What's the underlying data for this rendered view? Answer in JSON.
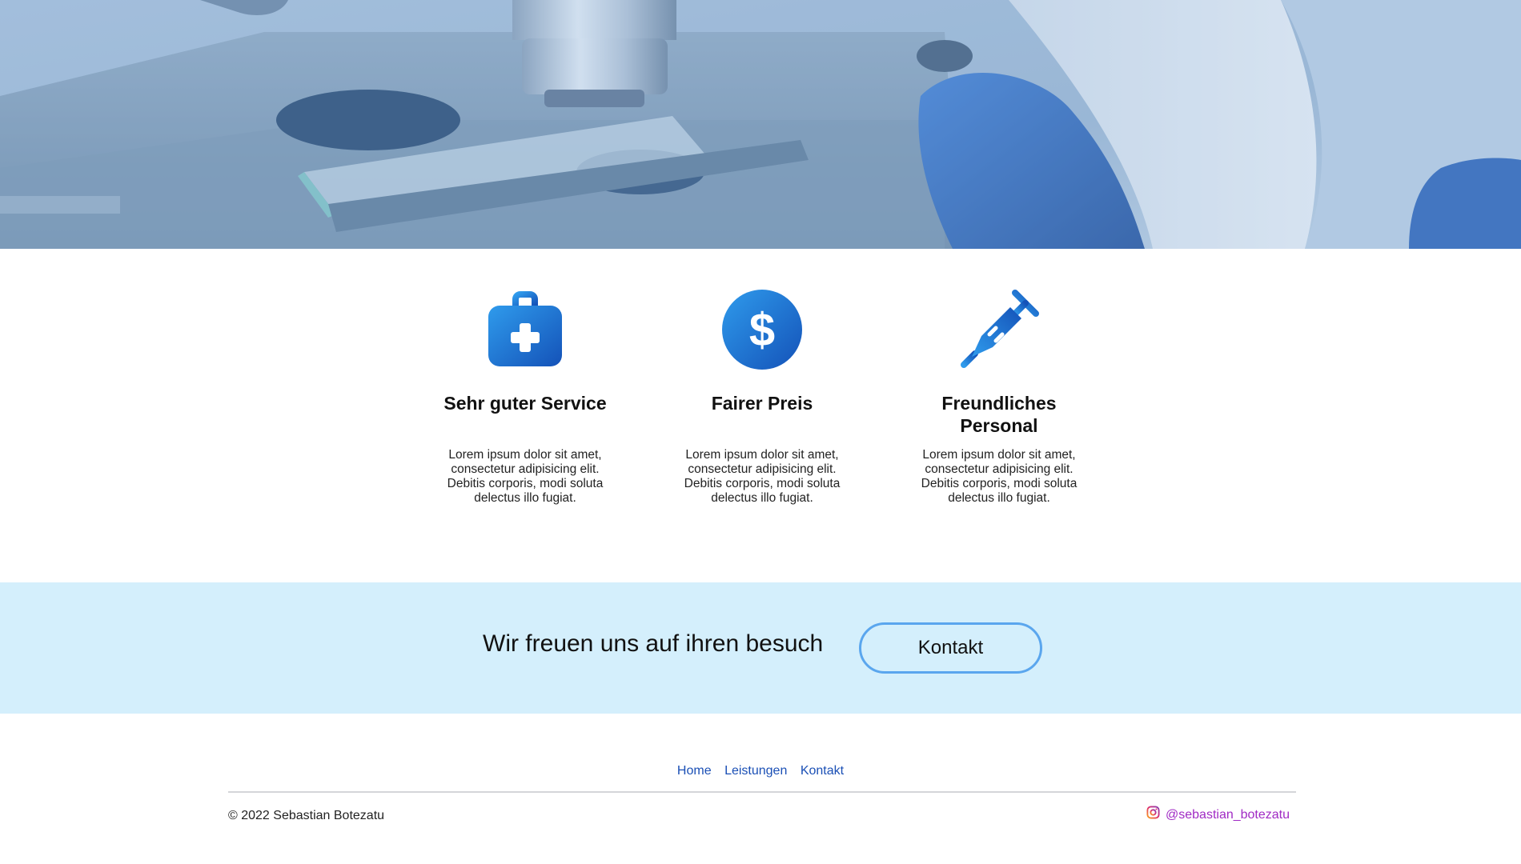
{
  "hero": {
    "image_alt": "microscope-slide-photo"
  },
  "features": [
    {
      "icon": "first-aid-kit-icon",
      "title": "Sehr guter Service",
      "text": "Lorem ipsum dolor sit amet, consectetur adipisicing elit. Debitis corporis, modi soluta delectus illo fugiat."
    },
    {
      "icon": "dollar-coin-icon",
      "title": "Fairer Preis",
      "text": "Lorem ipsum dolor sit amet, consectetur adipisicing elit. Debitis corporis, modi soluta delectus illo fugiat."
    },
    {
      "icon": "syringe-icon",
      "title": "Freundliches Personal",
      "text": "Lorem ipsum dolor sit amet, consectetur adipisicing elit. Debitis corporis, modi soluta delectus illo fugiat."
    }
  ],
  "cta": {
    "text": "Wir freuen uns auf ihren besuch",
    "button_label": "Kontakt"
  },
  "footer": {
    "nav": [
      "Home",
      "Leistungen",
      "Kontakt"
    ],
    "copyright": "© 2022 Sebastian Botezatu",
    "instagram_handle": "@sebastian_botezatu"
  },
  "colors": {
    "accent_blue": "#1e6fd9",
    "cta_bg": "#d4effc",
    "button_border": "#5aa6ee",
    "link": "#1a4fb5",
    "instagram": "#a02ac4"
  }
}
